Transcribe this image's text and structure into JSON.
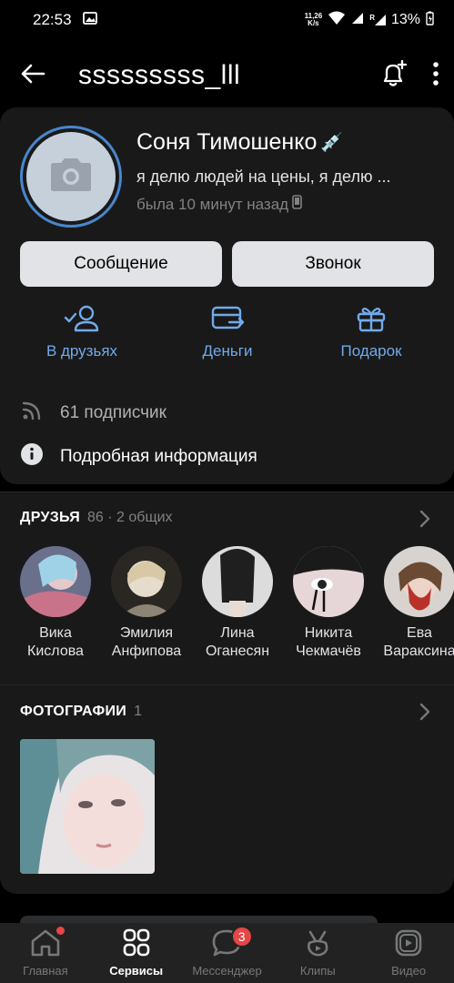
{
  "status_bar": {
    "time": "22:53",
    "net_speed_top": "11,26",
    "net_speed_bottom": "K/s",
    "sim": "R",
    "battery": "13%"
  },
  "header": {
    "title": "sssssssss_lll"
  },
  "profile": {
    "name": "Соня Тимошенко",
    "emoji": "💉",
    "status": "я делю людей на цены, я делю ...",
    "last_seen": "была 10 минут назад"
  },
  "buttons": {
    "message": "Сообщение",
    "call": "Звонок"
  },
  "actions": [
    {
      "label": "В друзьях",
      "icon": "friend-check-icon"
    },
    {
      "label": "Деньги",
      "icon": "money-card-icon"
    },
    {
      "label": "Подарок",
      "icon": "gift-icon"
    }
  ],
  "info": {
    "followers": "61 подписчик",
    "details": "Подробная информация"
  },
  "friends": {
    "title": "ДРУЗЬЯ",
    "count": "86 · 2 общих",
    "items": [
      {
        "first": "Вика",
        "last": "Кислова",
        "color": "#c9738a"
      },
      {
        "first": "Эмилия",
        "last": "Анфипова",
        "color": "#8c8474"
      },
      {
        "first": "Лина",
        "last": "Оганесян",
        "color": "#cfcfcf"
      },
      {
        "first": "Никита",
        "last": "Чекмачёв",
        "color": "#d9c3c6"
      },
      {
        "first": "Ева",
        "last": "Вараксина",
        "color": "#b85a4a"
      }
    ]
  },
  "photos": {
    "title": "ФОТОГРАФИИ",
    "count": "1"
  },
  "tabs": [
    {
      "label": "Главная",
      "icon": "home-icon",
      "active": false
    },
    {
      "label": "Сервисы",
      "icon": "services-icon",
      "active": true
    },
    {
      "label": "Мессенджер",
      "icon": "messenger-icon",
      "active": false,
      "badge": "3"
    },
    {
      "label": "Клипы",
      "icon": "clips-icon",
      "active": false
    },
    {
      "label": "Видео",
      "icon": "video-icon",
      "active": false
    }
  ],
  "colors": {
    "accent": "#71aaeb",
    "background": "#000000",
    "card": "#191919",
    "badge": "#e64646"
  }
}
